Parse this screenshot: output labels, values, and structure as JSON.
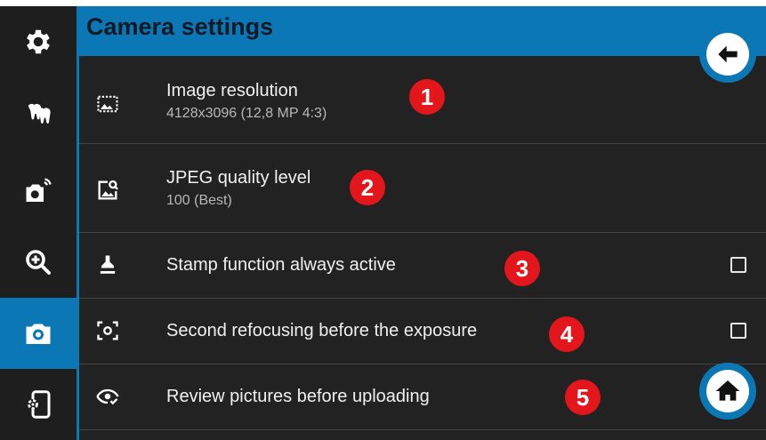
{
  "header": {
    "title": "Camera settings"
  },
  "sidebar": {
    "items": [
      {
        "icon": "gear-icon",
        "active": false
      },
      {
        "icon": "teeth-icon",
        "active": false
      },
      {
        "icon": "camera-wireless-icon",
        "active": false
      },
      {
        "icon": "zoom-in-icon",
        "active": false
      },
      {
        "icon": "camera-icon",
        "active": true
      },
      {
        "icon": "device-settings-icon",
        "active": false
      }
    ]
  },
  "settings": [
    {
      "icon": "image-resolution-icon",
      "title": "Image resolution",
      "subtitle": "4128x3096 (12,8 MP 4:3)",
      "badge": "1"
    },
    {
      "icon": "image-search-icon",
      "title": "JPEG quality level",
      "subtitle": "100 (Best)",
      "badge": "2"
    },
    {
      "icon": "stamp-icon",
      "title": "Stamp function always active",
      "checked": false,
      "badge": "3"
    },
    {
      "icon": "focus-icon",
      "title": "Second refocusing before the exposure",
      "checked": false,
      "badge": "4"
    },
    {
      "icon": "eye-check-icon",
      "title": "Review pictures before uploading",
      "badge": "5"
    }
  ],
  "buttons": {
    "back": "back-arrow-icon",
    "home": "home-icon"
  },
  "colors": {
    "accent": "#0b77b5",
    "badge": "#e3161b",
    "background": "#222222"
  }
}
